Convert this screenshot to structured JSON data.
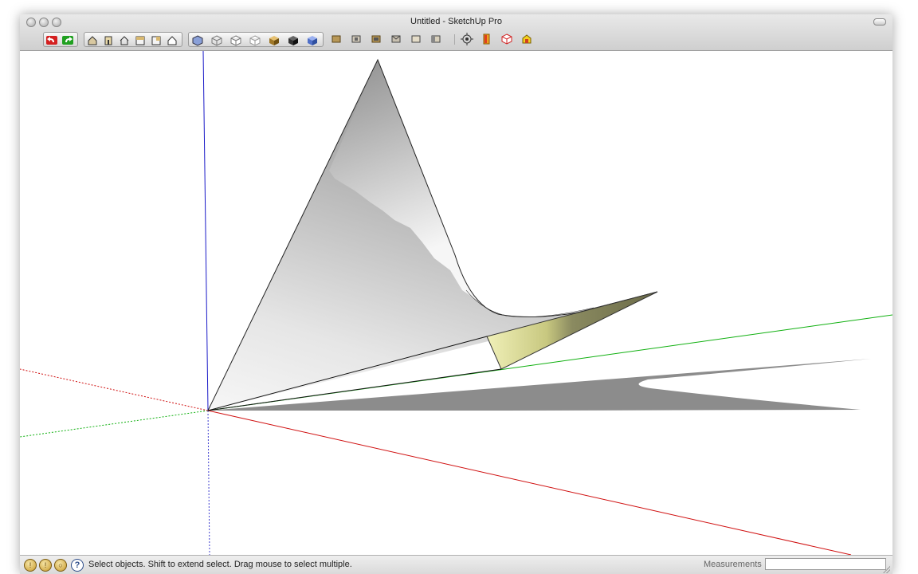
{
  "window": {
    "title": "Untitled - SketchUp Pro"
  },
  "toolbar": {
    "groups": [
      {
        "name": "undo-redo",
        "buttons": [
          "undo",
          "redo"
        ]
      },
      {
        "name": "views",
        "buttons": [
          "iso",
          "front",
          "top",
          "right",
          "back",
          "left"
        ]
      },
      {
        "name": "face-styles",
        "buttons": [
          "xray",
          "wireframe",
          "hidden-line",
          "shaded",
          "shaded-textures",
          "monochrome",
          "back-edges"
        ]
      },
      {
        "name": "sections",
        "buttons": [
          "section-1",
          "section-2",
          "section-3",
          "section-4",
          "section-5",
          "section-6"
        ]
      },
      {
        "name": "misc",
        "buttons": [
          "orbit",
          "paint",
          "components",
          "warehouse"
        ]
      }
    ]
  },
  "status": {
    "message": "Select objects. Shift to extend select. Drag mouse to select multiple.",
    "measurements_label": "Measurements",
    "measurements_value": ""
  },
  "colors": {
    "axis_red": "#d01010",
    "axis_green": "#10b010",
    "axis_blue": "#1010d0",
    "shadow": "#8c8c8c",
    "face_yellow": "#c8c880"
  }
}
